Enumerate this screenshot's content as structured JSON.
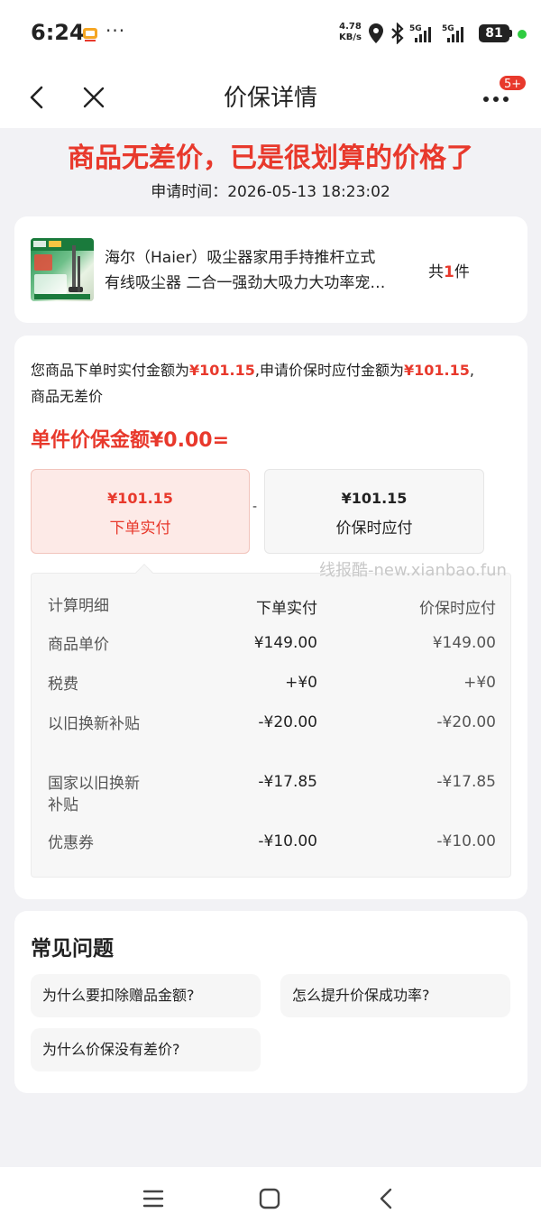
{
  "status_bar": {
    "time": "6:24",
    "dots": "···",
    "net_speed_value": "4.78",
    "net_speed_unit": "KB/s",
    "battery": "81"
  },
  "nav": {
    "title": "价保详情",
    "badge": "5+"
  },
  "headline": "商品无差价，已是很划算的价格了",
  "apply_time_label": "申请时间：",
  "apply_time": "2026-05-13 18:23:02",
  "product": {
    "title_line1": "海尔（Haier）吸尘器家用手持推杆立式",
    "title_line2": "有线吸尘器 二合一强劲大吸力大功率宠…",
    "count_prefix": "共",
    "count": "1",
    "count_suffix": "件"
  },
  "price_protect": {
    "desc_part1": "您商品下单时实付金额为",
    "paid_amount_inline": "¥101.15",
    "desc_part2": ",申请价保时应付金额为",
    "due_amount_inline": "¥101.15",
    "desc_part3": ",",
    "desc_part4": "商品无差价",
    "unit_protect_amount": "单件价保金额¥0.00=",
    "paid_box": {
      "amount": "¥101.15",
      "label": "下单实付"
    },
    "minus": "-",
    "due_box": {
      "amount": "¥101.15",
      "label": "价保时应付"
    },
    "watermark": "线报酷-new.xianbao.fun"
  },
  "detail": {
    "headers": [
      "计算明细",
      "下单实付",
      "价保时应付"
    ],
    "rows": [
      {
        "label": "商品单价",
        "paid": "¥149.00",
        "due": "¥149.00"
      },
      {
        "label": "税费",
        "paid": "+¥0",
        "due": "+¥0"
      },
      {
        "label": "以旧换新补贴",
        "paid": "-¥20.00",
        "due": "-¥20.00"
      },
      {
        "label": "国家以旧换新补贴",
        "paid": "-¥17.85",
        "due": "-¥17.85"
      },
      {
        "label": "优惠券",
        "paid": "-¥10.00",
        "due": "-¥10.00"
      }
    ]
  },
  "faq": {
    "title": "常见问题",
    "items": [
      "为什么要扣除赠品金额?",
      "怎么提升价保成功率?",
      "为什么价保没有差价?"
    ]
  },
  "colors": {
    "accent_red": "#e8392c",
    "background": "#f2f2f5",
    "card": "#ffffff"
  },
  "icons": {
    "nav_back": "chevron-left-icon",
    "nav_close": "close-icon",
    "nav_more": "more-icon",
    "bottom_menu": "menu-icon",
    "bottom_home": "home-icon",
    "bottom_back": "back-icon"
  }
}
